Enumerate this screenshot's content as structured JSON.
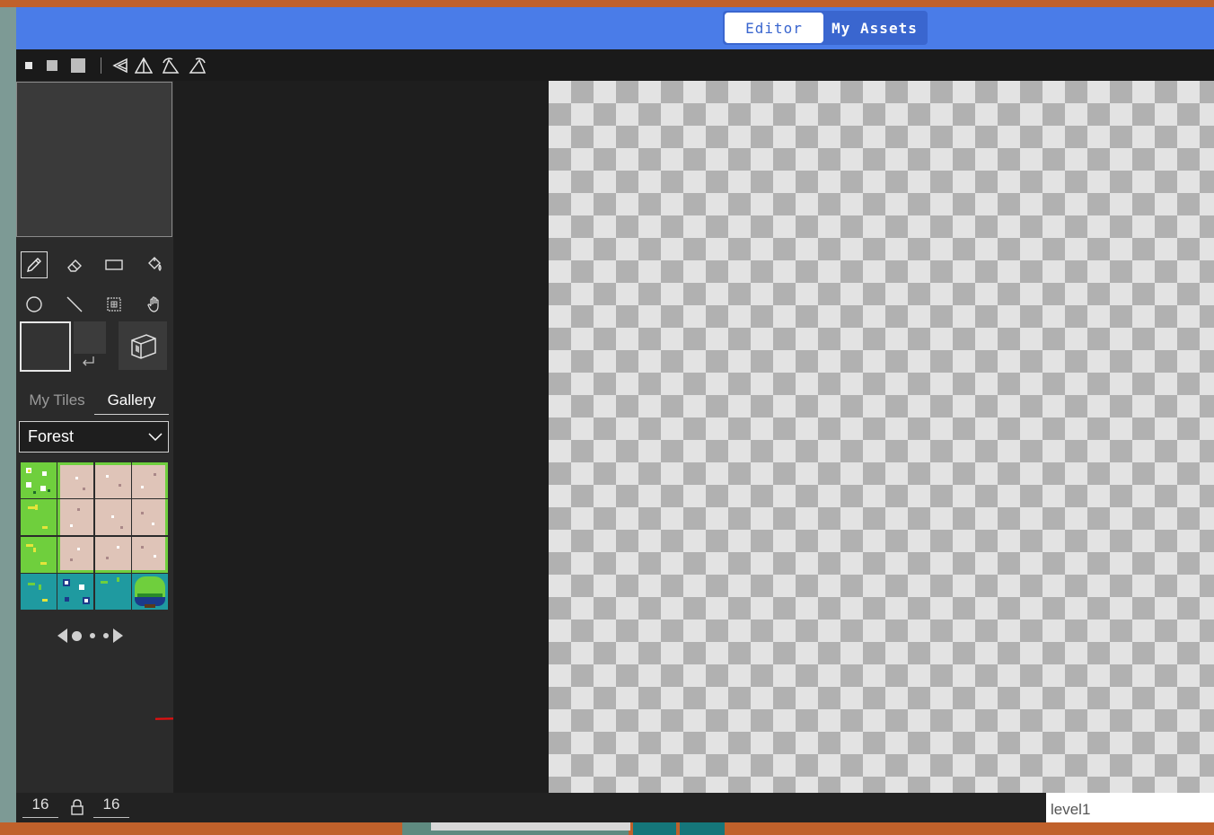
{
  "topbar": {
    "tabs": [
      {
        "label": "Editor",
        "active": true
      },
      {
        "label": "My Assets",
        "active": false
      }
    ],
    "accent_color": "#4a7ce8"
  },
  "toolstrip": {
    "brush_sizes": [
      "brush-size-small-icon",
      "brush-size-medium-icon",
      "brush-size-large-icon"
    ],
    "transforms": [
      "flip-horizontal-icon",
      "flip-vertical-icon",
      "rotate-left-icon",
      "rotate-right-icon"
    ]
  },
  "tools": {
    "row1": [
      "pencil-icon",
      "eraser-icon",
      "rectangle-icon",
      "fill-bucket-icon"
    ],
    "row2": [
      "circle-icon",
      "line-icon",
      "select-grid-icon",
      "hand-icon"
    ],
    "selected": "pencil-icon"
  },
  "colors": {
    "primary": "#333333",
    "secondary": "#3c3c3c"
  },
  "asset_tabs": {
    "my_tiles": "My Tiles",
    "gallery": "Gallery",
    "active": "Gallery"
  },
  "tileset_select": {
    "value": "Forest"
  },
  "pager": {
    "pages": 3,
    "current": 1
  },
  "footer": {
    "width": "16",
    "height": "16",
    "level_name": "level1"
  }
}
